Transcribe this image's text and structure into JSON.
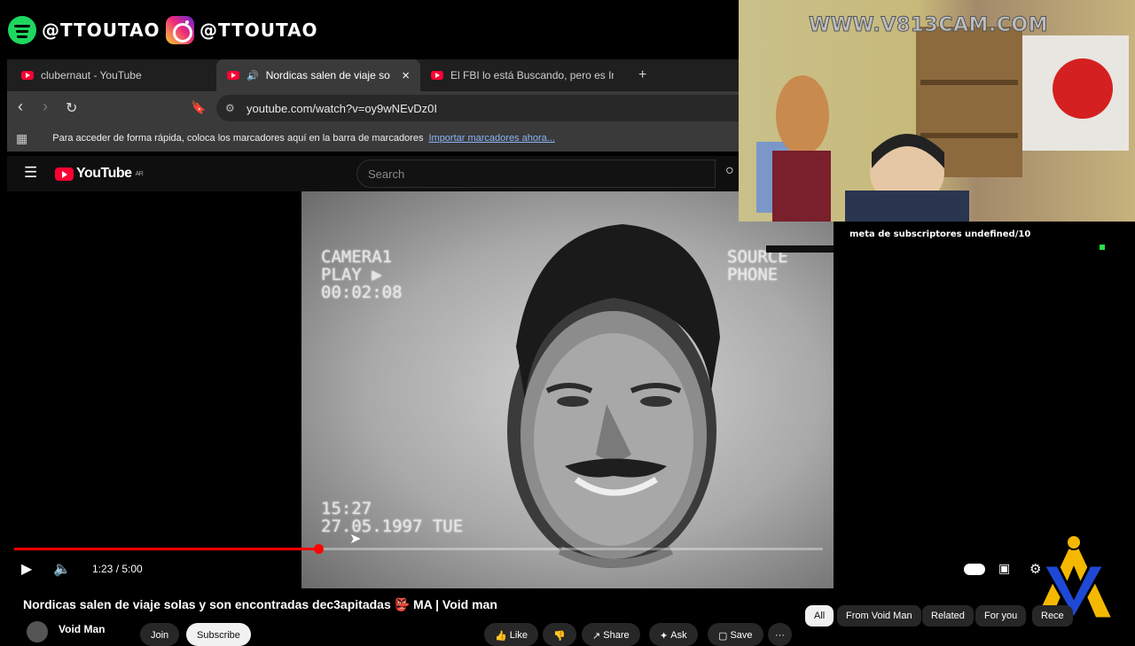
{
  "social": {
    "spotify_handle": "@TTOUTAO",
    "instagram_handle": "@TTOUTAO"
  },
  "browser": {
    "tabs": [
      {
        "label": "clubernaut - YouTube"
      },
      {
        "label": "Nordicas salen de viaje solas y"
      },
      {
        "label": "El FBI lo está Buscando, pero es Impo"
      }
    ],
    "new_tab_glyph": "+",
    "close_glyph": "×",
    "url": "youtube.com/watch?v=oy9wNEvDz0I",
    "bookmarks_hint": "Para acceder de forma rápida, coloca los marcadores aquí en la barra de marcadores",
    "bookmarks_link": "Importar marcadores ahora..."
  },
  "youtube": {
    "logo_text": "YouTube",
    "region": "AR",
    "search_placeholder": "Search"
  },
  "video": {
    "overlay_top_left": [
      "CAMERA1",
      "PLAY ▶",
      "00:02:08"
    ],
    "overlay_top_right": [
      "SOURCE",
      "PHONE"
    ],
    "overlay_time": "15:27",
    "overlay_date": "27.05.1997 TUE",
    "current_time": "1:23",
    "duration": "5:00",
    "time_display": "1:23 / 5:00",
    "progress_fraction": 0.3756
  },
  "cam": {
    "watermark": "WWW.V813CAM.COM",
    "subscriber_goal": "meta de subscriptores undefined/10"
  },
  "below": {
    "title": "Nordicas salen de viaje solas y son encontradas dec3apitadas 👺 MA | Void man",
    "channel": "Void Man",
    "join": "Join",
    "subscribe": "Subscribe",
    "like": "Like",
    "share": "Share",
    "ask": "Ask",
    "save": "Save",
    "more": "···",
    "chips": [
      "All",
      "From Void Man",
      "Related",
      "For you",
      "Rece"
    ]
  },
  "colors": {
    "accent_red": "#ff0033",
    "spotify_green": "#1ed760",
    "link_blue": "#8ab4f8"
  }
}
